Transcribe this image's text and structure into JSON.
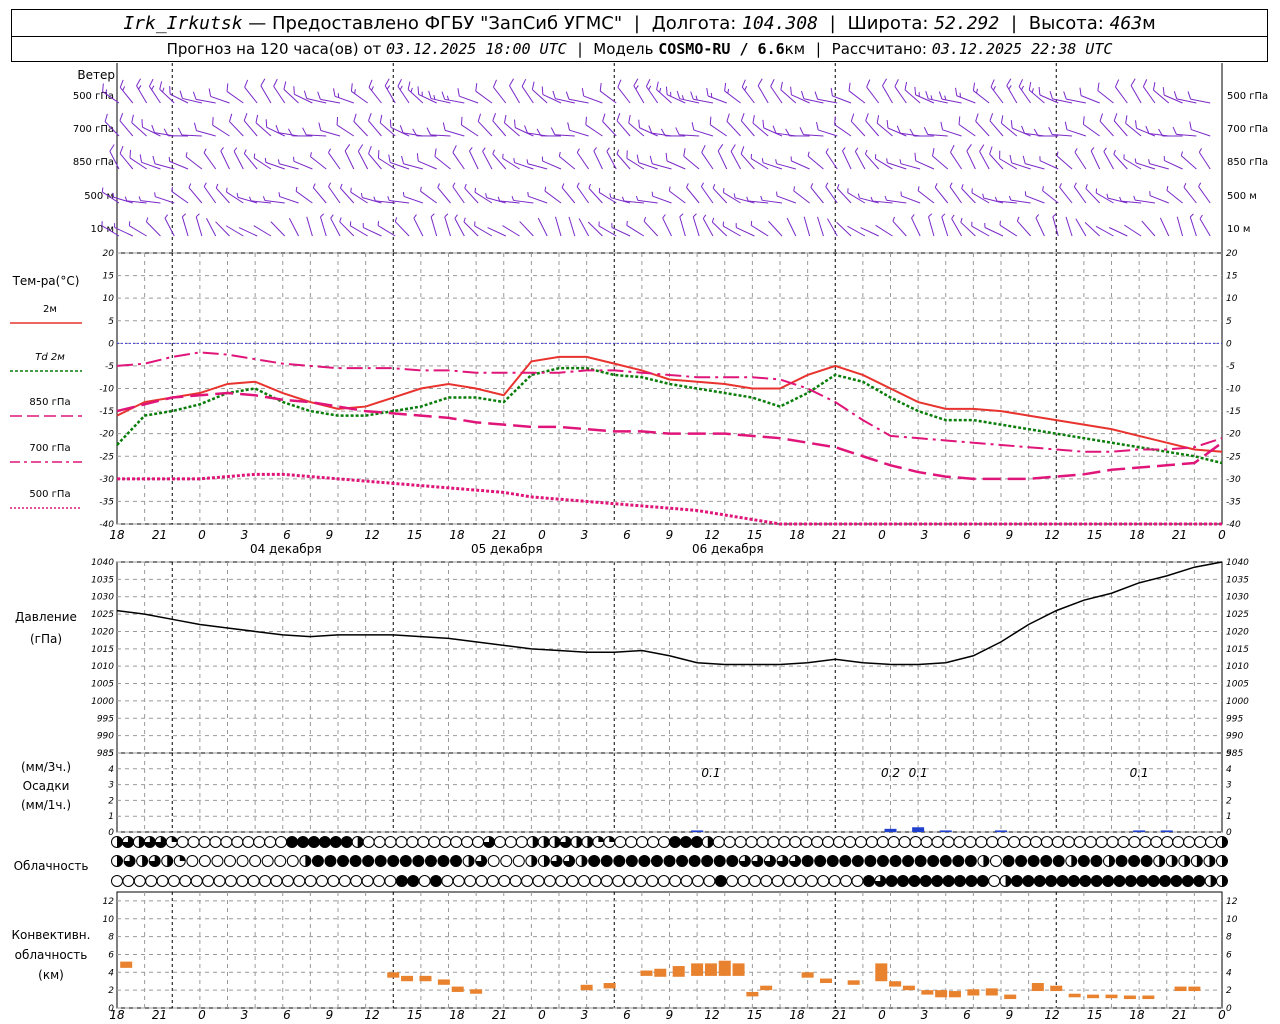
{
  "header": {
    "station": "Irk_Irkutsk",
    "provider": "— Предоставлено ФГБУ \"ЗапСиб УГМС\"",
    "lon_label": "Долгота:",
    "lon_value": "104.308",
    "lat_label": "Широта:",
    "lat_value": "52.292",
    "alt_label": "Высота:",
    "alt_value": "463",
    "alt_unit": "м",
    "forecast_label": "Прогноз на 120 часа(ов) от",
    "forecast_time": "03.12.2025 18:00 UTC",
    "model_label": "Модель",
    "model_name": "COSMO-RU / 6.6",
    "model_unit": "км",
    "calc_label": "Рассчитано:",
    "calc_time": "03.12.2025 22:38 UTC"
  },
  "wind_panel": {
    "title": "Ветер",
    "levels": [
      "500 гПа",
      "700 гПа",
      "850 гПа",
      "500 м",
      "10 м"
    ]
  },
  "temp_panel": {
    "title": "Тем-ра(°С)",
    "legend": [
      {
        "label": "2м",
        "color": "#e8332e",
        "style": "solid"
      },
      {
        "label": "Td 2м",
        "color": "#0a7d0a",
        "style": "dotted"
      },
      {
        "label": "850 гПа",
        "color": "#e0157a",
        "style": "longdash"
      },
      {
        "label": "700 гПа",
        "color": "#e0157a",
        "style": "dashdot"
      },
      {
        "label": "500 гПа",
        "color": "#e0157a",
        "style": "dense-dot"
      }
    ]
  },
  "pressure_panel": {
    "title": "Давление",
    "unit": "(гПа)"
  },
  "precip_panel": {
    "unit1": "(мм/3ч.)",
    "title": "Осадки",
    "unit2": "(мм/1ч.)"
  },
  "cloud_panel": {
    "title": "Облачность"
  },
  "conv_panel": {
    "title1": "Конвективн.",
    "title2": "облачность",
    "unit": "(км)"
  },
  "time_axis": {
    "hour_labels": [
      "18",
      "21",
      "0",
      "3",
      "6",
      "9",
      "12",
      "15",
      "18",
      "21",
      "0",
      "3",
      "6",
      "9",
      "12",
      "15",
      "18",
      "21",
      "0",
      "3",
      "6",
      "9",
      "12",
      "15",
      "18",
      "21",
      "0"
    ],
    "day_labels": [
      "04 декабря",
      "05 декабря",
      "06 декабря"
    ]
  },
  "chart_data": [
    {
      "type": "line",
      "title": "Тем-ра(°С)",
      "x_hours": [
        0,
        3,
        6,
        9,
        12,
        15,
        18,
        21,
        24,
        27,
        30,
        33,
        36,
        39,
        42,
        45,
        48,
        51,
        54,
        57,
        60,
        63,
        66,
        69,
        72,
        75,
        78,
        81,
        84,
        87,
        90,
        93,
        96,
        99,
        102,
        105,
        108,
        111,
        114,
        117,
        120
      ],
      "ylim": [
        -40,
        20
      ],
      "yticks": [
        20,
        15,
        10,
        5,
        0,
        -5,
        -10,
        -15,
        -20,
        -25,
        -30,
        -35,
        -40
      ],
      "series": [
        {
          "name": "2м",
          "values": [
            -16,
            -13,
            -12,
            -11,
            -9,
            -8.5,
            -11,
            -13,
            -14.5,
            -14,
            -12,
            -10,
            -9,
            -10,
            -11.5,
            -4,
            -3,
            -3,
            -4.5,
            -6,
            -8,
            -8.5,
            -9,
            -10,
            -10,
            -7,
            -5,
            -7,
            -10,
            -13,
            -14.5,
            -14.5,
            -15,
            -16,
            -17,
            -18,
            -19,
            -20.5,
            -22,
            -23.5,
            -24
          ]
        },
        {
          "name": "Td 2м",
          "values": [
            -22.5,
            -16,
            -15,
            -13.5,
            -11,
            -10,
            -13,
            -15,
            -16,
            -16,
            -15,
            -14,
            -12,
            -12,
            -13,
            -7,
            -5.5,
            -5.5,
            -7,
            -7.5,
            -9,
            -10,
            -11,
            -12,
            -14,
            -11,
            -7,
            -8.5,
            -12,
            -15,
            -17,
            -17,
            -18,
            -19,
            -20,
            -21,
            -22,
            -23,
            -24,
            -25,
            -26.5
          ]
        },
        {
          "name": "850 гПа",
          "values": [
            -15,
            -13.5,
            -12,
            -11.5,
            -11,
            -11.5,
            -12.5,
            -13,
            -14,
            -15,
            -15.5,
            -16,
            -16.5,
            -17.5,
            -18,
            -18.5,
            -18.5,
            -19,
            -19.5,
            -19.5,
            -20,
            -20,
            -20,
            -20.5,
            -21,
            -22,
            -23,
            -25,
            -27,
            -28.5,
            -29.5,
            -30,
            -30,
            -30,
            -29.5,
            -29,
            -28,
            -27.5,
            -27,
            -26.5,
            -22
          ]
        },
        {
          "name": "700 гПа",
          "values": [
            -5,
            -4.5,
            -3,
            -2,
            -2.5,
            -3.5,
            -4.5,
            -5,
            -5.5,
            -5.5,
            -5.5,
            -6,
            -6,
            -6.5,
            -6.5,
            -6.5,
            -6.5,
            -6,
            -6,
            -6.5,
            -7,
            -7.5,
            -7.5,
            -7.5,
            -8,
            -10,
            -13,
            -17,
            -20.5,
            -21,
            -21.5,
            -22,
            -22.5,
            -23,
            -23.5,
            -24,
            -24,
            -23.5,
            -23.5,
            -23,
            -21
          ]
        },
        {
          "name": "500 гПа",
          "values": [
            -30,
            -30,
            -30,
            -30,
            -29.5,
            -29,
            -29,
            -29.5,
            -30,
            -30.5,
            -31,
            -31.5,
            -32,
            -32.5,
            -33,
            -34,
            -34.5,
            -35,
            -35.5,
            -36,
            -36.5,
            -37,
            -38,
            -39,
            -40,
            -41,
            -42,
            -42,
            -42,
            -42,
            -42,
            -42,
            -42,
            -42,
            -42,
            -42,
            -42,
            -42,
            -42,
            -41,
            -40
          ]
        }
      ]
    },
    {
      "type": "line",
      "title": "Давление",
      "ylabel": "(гПа)",
      "ylim": [
        985,
        1040
      ],
      "yticks": [
        1040,
        1035,
        1030,
        1025,
        1020,
        1015,
        1010,
        1005,
        1000,
        995,
        990,
        985
      ],
      "x_hours": [
        0,
        3,
        6,
        9,
        12,
        15,
        18,
        21,
        24,
        27,
        30,
        33,
        36,
        39,
        42,
        45,
        48,
        51,
        54,
        57,
        60,
        63,
        66,
        69,
        72,
        75,
        78,
        81,
        84,
        87,
        90,
        93,
        96,
        99,
        102,
        105,
        108,
        111,
        114,
        117,
        120
      ],
      "values": [
        1026,
        1025,
        1023.5,
        1022,
        1021,
        1020,
        1019,
        1018.5,
        1019,
        1019,
        1019,
        1018.5,
        1018,
        1017,
        1016,
        1015,
        1014.5,
        1014,
        1014,
        1014.5,
        1013,
        1011,
        1010.5,
        1010.5,
        1010.5,
        1011,
        1012,
        1011,
        1010.5,
        1010.5,
        1011,
        1013,
        1017,
        1022,
        1026,
        1029,
        1031,
        1034,
        1036,
        1038.5,
        1040
      ]
    },
    {
      "type": "bar",
      "title": "Осадки",
      "x_hours": [
        63,
        84,
        87,
        90,
        96,
        111,
        114
      ],
      "values": [
        0.1,
        0.2,
        0.3,
        0.1,
        0.1,
        0.1,
        0.1
      ],
      "labels": [
        {
          "x_hours": 64.5,
          "text": "0.1"
        },
        {
          "x_hours": 84,
          "text": "0.2"
        },
        {
          "x_hours": 87,
          "text": "0.1"
        },
        {
          "x_hours": 111,
          "text": "0.1"
        }
      ],
      "ylim": [
        0,
        5
      ]
    },
    {
      "type": "table",
      "title": "Облачность",
      "note": "3 rows of cloud symbols (0=clear, 1=quarter, 2=half, 3=three-quarter, 4=overcast)",
      "rows": [
        [
          2,
          3,
          2,
          3,
          3,
          1,
          0,
          0,
          0,
          0,
          0,
          0,
          0,
          0,
          0,
          0,
          4,
          4,
          4,
          4,
          4,
          4,
          2,
          0,
          0,
          0,
          0,
          0,
          0,
          0,
          0,
          0,
          0,
          0,
          3,
          0,
          0,
          0,
          2,
          2,
          2,
          3,
          2,
          2,
          1,
          1,
          0,
          0,
          0,
          0,
          0,
          4,
          4,
          4,
          2,
          0,
          0,
          0,
          0,
          0,
          0,
          0,
          0,
          0,
          0,
          0,
          0,
          0,
          0,
          0,
          0,
          0,
          0,
          0,
          0,
          0,
          0,
          0,
          0,
          0,
          0,
          0,
          0,
          0,
          0,
          0,
          0,
          0,
          0,
          0,
          0,
          0,
          0,
          0,
          0,
          0,
          0,
          0,
          0,
          0,
          0,
          2
        ],
        [
          2,
          3,
          2,
          3,
          2,
          1,
          0,
          0,
          0,
          0,
          0,
          0,
          0,
          0,
          0,
          2,
          4,
          4,
          4,
          4,
          4,
          4,
          4,
          4,
          4,
          4,
          4,
          4,
          2,
          3,
          0,
          0,
          0,
          2,
          2,
          3,
          3,
          2,
          4,
          4,
          4,
          4,
          4,
          4,
          4,
          4,
          4,
          4,
          4,
          4,
          3,
          3,
          3,
          3,
          3,
          4,
          4,
          4,
          4,
          4,
          4,
          4,
          4,
          4,
          4,
          4,
          4,
          4,
          4,
          2,
          0,
          4,
          4,
          4,
          4,
          4,
          2,
          4,
          4,
          2,
          4,
          4,
          4,
          2,
          2,
          2,
          2,
          2,
          2
        ],
        [
          0,
          0,
          0,
          0,
          0,
          0,
          0,
          0,
          0,
          0,
          0,
          0,
          0,
          0,
          0,
          0,
          0,
          0,
          0,
          0,
          0,
          0,
          0,
          0,
          0,
          4,
          4,
          0,
          4,
          0,
          0,
          0,
          0,
          0,
          0,
          0,
          0,
          0,
          0,
          0,
          0,
          0,
          0,
          0,
          0,
          0,
          0,
          0,
          0,
          0,
          0,
          0,
          0,
          4,
          0,
          0,
          0,
          0,
          0,
          0,
          0,
          0,
          0,
          0,
          0,
          0,
          4,
          3,
          4,
          4,
          4,
          4,
          4,
          4,
          4,
          4,
          4,
          0,
          2,
          4,
          4,
          4,
          4,
          4,
          4,
          4,
          4,
          4,
          4,
          4,
          4,
          4,
          4,
          4,
          4,
          4,
          2,
          2
        ]
      ]
    },
    {
      "type": "bar",
      "title": "Конвективн. облачность (км)",
      "ylim": [
        0,
        13
      ],
      "yticks": [
        12,
        10,
        8,
        6,
        4,
        2,
        0
      ],
      "bars": [
        {
          "x_hours": 1,
          "bottom": 4.5,
          "top": 5.2
        },
        {
          "x_hours": 30,
          "bottom": 3.4,
          "top": 4.0
        },
        {
          "x_hours": 31.5,
          "bottom": 3.0,
          "top": 3.6
        },
        {
          "x_hours": 33.5,
          "bottom": 3.0,
          "top": 3.6
        },
        {
          "x_hours": 35.5,
          "bottom": 2.6,
          "top": 3.2
        },
        {
          "x_hours": 37,
          "bottom": 1.8,
          "top": 2.4
        },
        {
          "x_hours": 39,
          "bottom": 1.6,
          "top": 2.1
        },
        {
          "x_hours": 51,
          "bottom": 2.0,
          "top": 2.6
        },
        {
          "x_hours": 53.5,
          "bottom": 2.2,
          "top": 2.8
        },
        {
          "x_hours": 57.5,
          "bottom": 3.6,
          "top": 4.2
        },
        {
          "x_hours": 59,
          "bottom": 3.5,
          "top": 4.4
        },
        {
          "x_hours": 61,
          "bottom": 3.5,
          "top": 4.7
        },
        {
          "x_hours": 63,
          "bottom": 3.6,
          "top": 5.0
        },
        {
          "x_hours": 64.5,
          "bottom": 3.6,
          "top": 5.0
        },
        {
          "x_hours": 66,
          "bottom": 3.6,
          "top": 5.3
        },
        {
          "x_hours": 67.5,
          "bottom": 3.6,
          "top": 5.0
        },
        {
          "x_hours": 69,
          "bottom": 1.3,
          "top": 1.8
        },
        {
          "x_hours": 70.5,
          "bottom": 2.0,
          "top": 2.5
        },
        {
          "x_hours": 75,
          "bottom": 3.4,
          "top": 4.0
        },
        {
          "x_hours": 77,
          "bottom": 2.8,
          "top": 3.3
        },
        {
          "x_hours": 80,
          "bottom": 2.6,
          "top": 3.1
        },
        {
          "x_hours": 83,
          "bottom": 3.0,
          "top": 5.0
        },
        {
          "x_hours": 84.5,
          "bottom": 2.4,
          "top": 3.0
        },
        {
          "x_hours": 86,
          "bottom": 2.0,
          "top": 2.5
        },
        {
          "x_hours": 88,
          "bottom": 1.5,
          "top": 2.0
        },
        {
          "x_hours": 89.5,
          "bottom": 1.2,
          "top": 2.0
        },
        {
          "x_hours": 91,
          "bottom": 1.2,
          "top": 1.9
        },
        {
          "x_hours": 93,
          "bottom": 1.4,
          "top": 2.1
        },
        {
          "x_hours": 95,
          "bottom": 1.4,
          "top": 2.2
        },
        {
          "x_hours": 97,
          "bottom": 1.0,
          "top": 1.5
        },
        {
          "x_hours": 100,
          "bottom": 1.9,
          "top": 2.8
        },
        {
          "x_hours": 102,
          "bottom": 1.9,
          "top": 2.5
        },
        {
          "x_hours": 104,
          "bottom": 1.2,
          "top": 1.6
        },
        {
          "x_hours": 106,
          "bottom": 1.1,
          "top": 1.5
        },
        {
          "x_hours": 108,
          "bottom": 1.1,
          "top": 1.5
        },
        {
          "x_hours": 110,
          "bottom": 1.0,
          "top": 1.4
        },
        {
          "x_hours": 112,
          "bottom": 1.0,
          "top": 1.4
        },
        {
          "x_hours": 115.5,
          "bottom": 1.9,
          "top": 2.4
        },
        {
          "x_hours": 117,
          "bottom": 1.9,
          "top": 2.4
        }
      ]
    }
  ],
  "colors": {
    "wind": "#7a28c8",
    "temp2m": "#e8332e",
    "td": "#0a7d0a",
    "upper": "#e0157a",
    "zero_line": "#3a3ad0",
    "pressure": "#000000",
    "precip": "#1f3fcf",
    "conv": "#e8822e",
    "grid": "#9a9a9a"
  }
}
